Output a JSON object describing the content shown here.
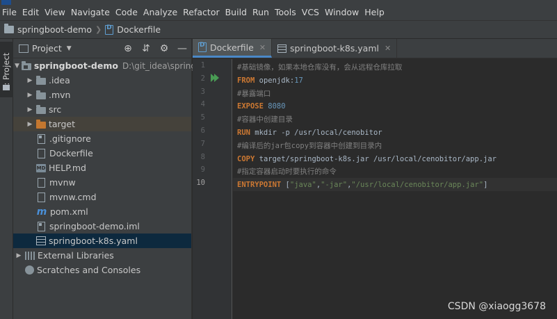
{
  "menubar": {
    "items": [
      "File",
      "Edit",
      "View",
      "Navigate",
      "Code",
      "Analyze",
      "Refactor",
      "Build",
      "Run",
      "Tools",
      "VCS",
      "Window",
      "Help"
    ]
  },
  "navbar": {
    "project": "springboot-demo",
    "file": "Dockerfile"
  },
  "left_stripe": {
    "project_tab": "1: Project"
  },
  "project_panel": {
    "title": "Project",
    "tree": {
      "root_name": "springboot-demo",
      "root_path": "D:\\git_idea\\spring",
      "items": [
        {
          "label": ".idea"
        },
        {
          "label": ".mvn"
        },
        {
          "label": "src"
        },
        {
          "label": "target"
        },
        {
          "label": ".gitignore"
        },
        {
          "label": "Dockerfile"
        },
        {
          "label": "HELP.md"
        },
        {
          "label": "mvnw"
        },
        {
          "label": "mvnw.cmd"
        },
        {
          "label": "pom.xml"
        },
        {
          "label": "springboot-demo.iml"
        },
        {
          "label": "springboot-k8s.yaml"
        }
      ],
      "external_libraries": "External Libraries",
      "scratches": "Scratches and Consoles"
    }
  },
  "tabs": [
    {
      "label": "Dockerfile",
      "active": true
    },
    {
      "label": "springboot-k8s.yaml",
      "active": false
    }
  ],
  "editor": {
    "line_numbers": [
      "1",
      "2",
      "3",
      "4",
      "5",
      "6",
      "7",
      "8",
      "9",
      "10"
    ],
    "current_line": 10,
    "lines": [
      [
        {
          "t": "#基础镜像，如果本地仓库没有，会从远程仓库拉取",
          "c": "comment"
        }
      ],
      [
        {
          "t": "FROM",
          "c": "kw"
        },
        {
          "t": " openjdk:",
          "c": "plain"
        },
        {
          "t": "17",
          "c": "num"
        }
      ],
      [
        {
          "t": "#暴露端口",
          "c": "comment"
        }
      ],
      [
        {
          "t": "EXPOSE",
          "c": "kw"
        },
        {
          "t": " ",
          "c": "plain"
        },
        {
          "t": "8080",
          "c": "num"
        }
      ],
      [
        {
          "t": "#容器中创建目录",
          "c": "comment"
        }
      ],
      [
        {
          "t": "RUN",
          "c": "kw"
        },
        {
          "t": " mkdir -p /usr/local/cenobitor",
          "c": "plain"
        }
      ],
      [
        {
          "t": "#编译后的jar包copy到容器中创建到目录内",
          "c": "comment"
        }
      ],
      [
        {
          "t": "COPY",
          "c": "kw"
        },
        {
          "t": " target/springboot-k8s.jar /usr/local/cenobitor/app.jar",
          "c": "plain"
        }
      ],
      [
        {
          "t": "#指定容器启动时要执行的命令",
          "c": "comment"
        }
      ],
      [
        {
          "t": "ENTRYPOINT",
          "c": "kw"
        },
        {
          "t": " [",
          "c": "plain"
        },
        {
          "t": "\"java\"",
          "c": "str"
        },
        {
          "t": ",",
          "c": "plain"
        },
        {
          "t": "\"-jar\"",
          "c": "str"
        },
        {
          "t": ",",
          "c": "plain"
        },
        {
          "t": "\"/usr/local/cenobitor/app.jar\"",
          "c": "str"
        },
        {
          "t": "]",
          "c": "plain"
        }
      ]
    ]
  },
  "watermark": "CSDN @xiaogg3678",
  "colors": {
    "comment": "#808080",
    "keyword": "#cc7832",
    "number": "#6897bb",
    "string": "#6a8759",
    "accent": "#4a88c7"
  }
}
